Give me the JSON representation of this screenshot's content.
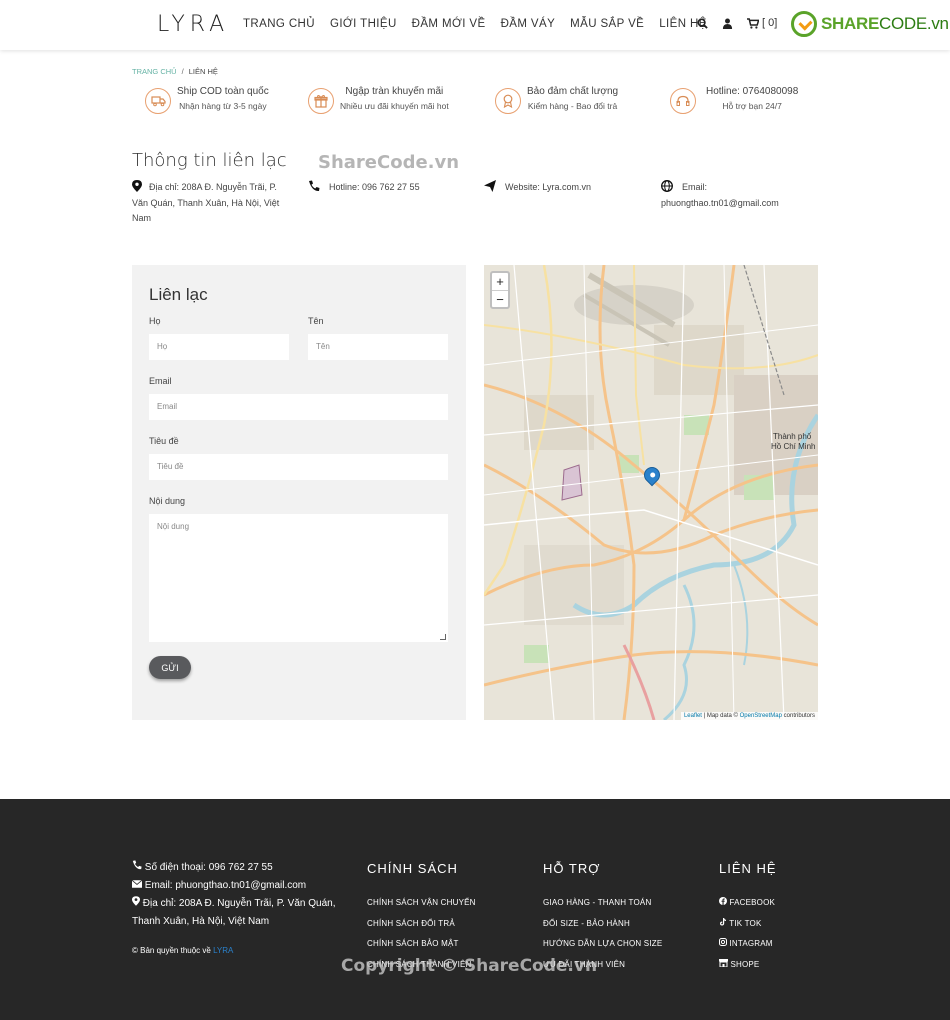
{
  "header": {
    "logo": "LYRA",
    "nav": [
      "TRANG CHỦ",
      "GIỚI THIỆU",
      "ĐẦM MỚI VỀ",
      "ĐẦM VÁY",
      "MẪU SẮP VỀ",
      "LIÊN HỆ"
    ],
    "cart_count": "[ 0]",
    "brand_part1": "SHARE",
    "brand_part2": "CODE.vn"
  },
  "breadcrumb": {
    "home": "TRANG CHỦ",
    "sep": "/",
    "current": "LIÊN HỆ"
  },
  "features": [
    {
      "icon": "truck-icon",
      "title": "Ship COD toàn quốc",
      "subtitle": "Nhận hàng từ 3-5 ngày"
    },
    {
      "icon": "gift-icon",
      "title": "Ngập tràn khuyến mãi",
      "subtitle": "Nhiều ưu đãi khuyến mãi hot"
    },
    {
      "icon": "badge-icon",
      "title": "Bảo đảm chất lượng",
      "subtitle": "Kiểm hàng - Bao đổi trả"
    },
    {
      "icon": "headset-icon",
      "title": "Hotline: 0764080098",
      "subtitle": "Hỗ trợ bạn 24/7"
    }
  ],
  "info": {
    "title": "Thông tin liên lạc",
    "watermark": "ShareCode.vn",
    "address": "Địa chỉ: 208A Đ. Nguyễn Trãi, P. Văn Quán, Thanh Xuân, Hà Nội, Việt Nam",
    "hotline": "Hotline: 096 762 27 55",
    "website": "Website: Lyra.com.vn",
    "email": "Email: phuongthao.tn01@gmail.com"
  },
  "form": {
    "title": "Liên lạc",
    "last_name_label": "Họ",
    "last_name_placeholder": "Họ",
    "first_name_label": "Tên",
    "first_name_placeholder": "Tên",
    "email_label": "Email",
    "email_placeholder": "Email",
    "subject_label": "Tiêu đề",
    "subject_placeholder": "Tiêu đề",
    "content_label": "Nội dung",
    "content_placeholder": "Nội dung",
    "send_label": "GỬI"
  },
  "map": {
    "zoom_in": "+",
    "zoom_out": "−",
    "attr_leaflet": "Leaflet",
    "attr_mid": " | Map data © ",
    "attr_osm": "OpenStreetMap",
    "attr_end": " contributors",
    "city_label_1": "Thành phố",
    "city_label_2": "Hồ Chí Minh",
    "colors": {
      "land": "#e8e4d9",
      "major_road": "#f5c38a",
      "minor_road": "#ffffff",
      "park": "#c8e2b8",
      "water": "#aad3df",
      "pin": "#2a81cb"
    }
  },
  "footer": {
    "phone": "Số điện thoại: 096 762 27 55",
    "email": "Email: phuongthao.tn01@gmail.com",
    "address": "Địa chỉ: 208A Đ. Nguyễn Trãi, P. Văn Quán, Thanh Xuân, Hà Nội, Việt Nam",
    "copyright": "© Bản quyền thuộc về ",
    "copyright_brand": "LYRA",
    "watermark": "Copyright © ShareCode.vn",
    "policy_title": "CHÍNH SÁCH",
    "policy_links": [
      "CHÍNH SÁCH VẬN CHUYỂN",
      "CHÍNH SÁCH ĐỔI TRẢ",
      "CHÍNH SÁCH BẢO MẬT",
      "CHÍNH SÁCH THÀNH VIÊN"
    ],
    "support_title": "HỖ TRỢ",
    "support_links": [
      "GIAO HÀNG - THANH TOÁN",
      "ĐỔI SIZE - BẢO HÀNH",
      "HƯỚNG DẪN LỰA CHỌN SIZE",
      "ƯU ĐÃI THÀNH VIÊN"
    ],
    "contact_title": "LIÊN HỆ",
    "contact_links": [
      {
        "icon": "facebook-icon",
        "label": "FACEBOOK"
      },
      {
        "icon": "tiktok-icon",
        "label": "TIK TOK"
      },
      {
        "icon": "instagram-icon",
        "label": "INTAGRAM"
      },
      {
        "icon": "shop-icon",
        "label": "SHOPE"
      }
    ]
  }
}
